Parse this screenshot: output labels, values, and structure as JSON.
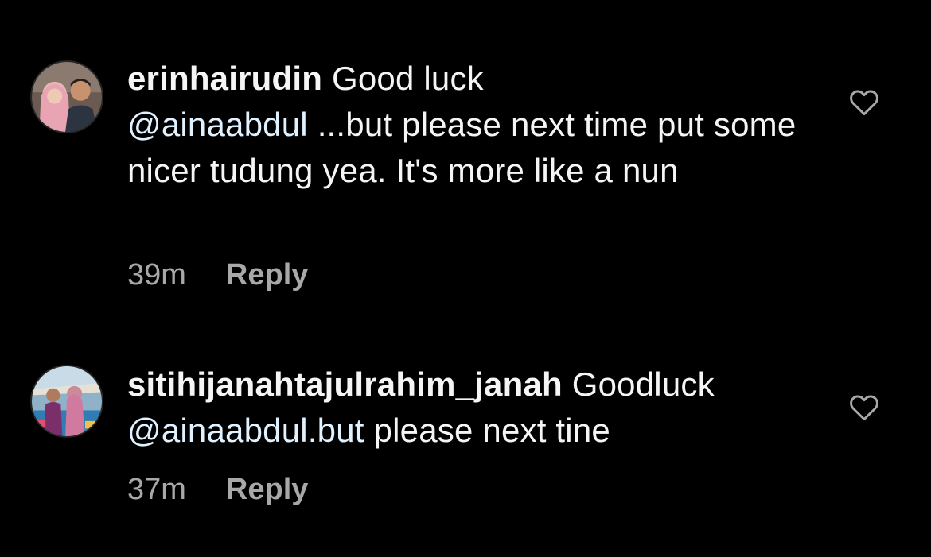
{
  "comments": [
    {
      "username": "erinhairudin",
      "text_before": "Good luck",
      "mention": "@ainaabdul",
      "text_after": "...but please next time put some nicer tudung yea. It's more like a nun",
      "time": "39m",
      "reply_label": "Reply",
      "like_icon": "heart-outline-icon"
    },
    {
      "username": "sitihijanahtajulrahim_janah",
      "text_before": "Goodluck",
      "mention": "@ainaabdul.but",
      "text_after": "please next tine",
      "time": "37m",
      "reply_label": "Reply",
      "like_icon": "heart-outline-icon"
    }
  ],
  "colors": {
    "background": "#000000",
    "text": "#f5f5f5",
    "mention": "#e0f1ff",
    "meta": "#a8a8a8"
  }
}
